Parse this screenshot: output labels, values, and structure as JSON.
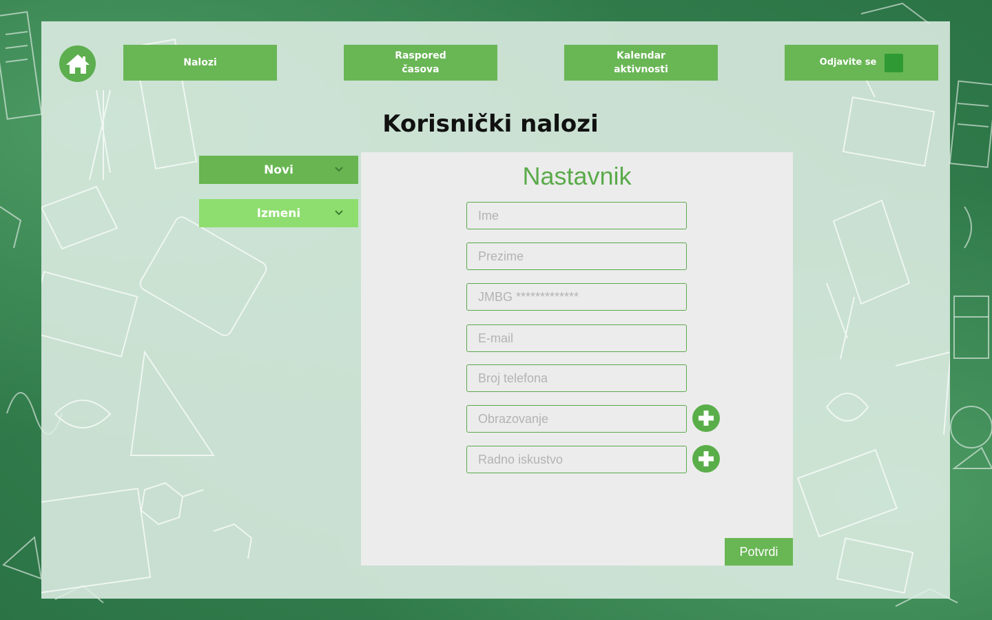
{
  "nav": {
    "home_icon": "home-icon",
    "items": [
      {
        "label": "Nalozi"
      },
      {
        "label_line1": "Raspored",
        "label_line2": "časova"
      },
      {
        "label_line1": "Kalendar",
        "label_line2": "aktivnosti"
      },
      {
        "label": "Odjavite se"
      }
    ]
  },
  "page": {
    "title": "Korisnički nalozi"
  },
  "sidebar": {
    "items": [
      {
        "label": "Novi",
        "icon": "chevron-down-icon"
      },
      {
        "label": "Izmeni",
        "icon": "chevron-down-icon"
      }
    ]
  },
  "form": {
    "title": "Nastavnik",
    "fields": [
      {
        "placeholder": "Ime",
        "value": ""
      },
      {
        "placeholder": "Prezime",
        "value": ""
      },
      {
        "placeholder": "JMBG *************",
        "value": ""
      },
      {
        "placeholder": "E-mail",
        "value": ""
      },
      {
        "placeholder": "Broj telefona",
        "value": ""
      },
      {
        "placeholder": "Obrazovanje",
        "value": "",
        "icon": "plus-icon"
      },
      {
        "placeholder": "Radno iskustvo",
        "value": "",
        "icon": "plus-icon"
      }
    ],
    "submit_label": "Potvrdi"
  },
  "colors": {
    "accent": "#69b655",
    "accent_light": "#8ede6f",
    "logout_square": "#2f9a33",
    "title_green": "#5aaa4a"
  }
}
